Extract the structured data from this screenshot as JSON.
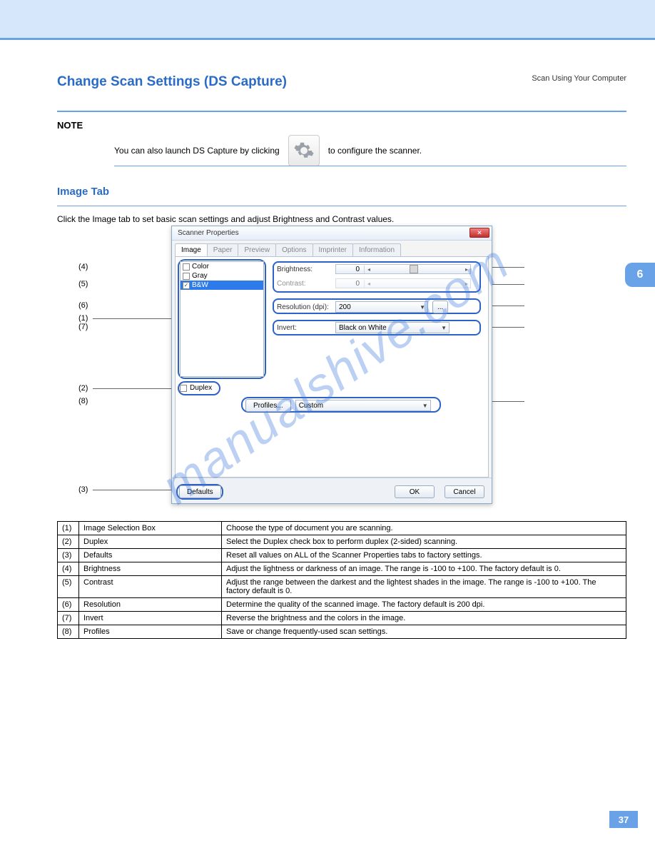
{
  "header": {
    "section_title": "Change Scan Settings (DS Capture)",
    "running_head": "Scan Using Your Computer"
  },
  "note": {
    "label": "NOTE",
    "text": "to configure the scanner."
  },
  "subhead": "Image Tab",
  "intro": "Click the Image tab to set basic scan settings and adjust Brightness and Contrast values.",
  "side_tab": "6",
  "dialog": {
    "title": "Scanner Properties",
    "tabs": [
      "Image",
      "Paper",
      "Preview",
      "Options",
      "Imprinter",
      "Information"
    ],
    "list": {
      "items": [
        "Color",
        "Gray",
        "B&W"
      ],
      "selected": "B&W"
    },
    "brightness": {
      "label": "Brightness:",
      "value": "0"
    },
    "contrast": {
      "label": "Contrast:",
      "value": "0"
    },
    "resolution": {
      "label": "Resolution (dpi):",
      "value": "200",
      "btn": "..."
    },
    "invert": {
      "label": "Invert:",
      "value": "Black on White"
    },
    "duplex": {
      "label": "Duplex"
    },
    "profiles": {
      "btn": "Profiles...",
      "value": "Custom"
    },
    "bottom": {
      "defaults": "Defaults",
      "ok": "OK",
      "cancel": "Cancel"
    }
  },
  "callouts": {
    "c1": "(1)",
    "c2": "(2)",
    "c3": "(3)",
    "c4": "(4)",
    "c5": "(5)",
    "c6": "(6)",
    "c7": "(7)",
    "c8": "(8)"
  },
  "table": {
    "rows": [
      {
        "n": "(1)",
        "name": "Image Selection Box",
        "desc": "Choose the type of document you are scanning."
      },
      {
        "n": "(2)",
        "name": "Duplex",
        "desc": "Select the Duplex check box to perform duplex (2-sided) scanning."
      },
      {
        "n": "(3)",
        "name": "Defaults",
        "desc": "Reset all values on ALL of the Scanner Properties tabs to factory settings."
      },
      {
        "n": "(4)",
        "name": "Brightness",
        "desc": "Adjust the lightness or darkness of an image. The range is -100 to +100. The factory default is 0."
      },
      {
        "n": "(5)",
        "name": "Contrast",
        "desc": "Adjust the range between the darkest and the lightest shades in the image. The range is -100 to +100. The factory default is 0."
      },
      {
        "n": "(6)",
        "name": "Resolution",
        "desc": "Determine the quality of the scanned image. The factory default is 200 dpi."
      },
      {
        "n": "(7)",
        "name": "Invert",
        "desc": "Reverse the brightness and the colors in the image."
      },
      {
        "n": "(8)",
        "name": "Profiles",
        "desc": "Save or change frequently-used scan settings."
      }
    ]
  },
  "footer_page": "37",
  "watermark": "manualshive.com",
  "note_prefix": "You can also launch DS Capture by clicking"
}
